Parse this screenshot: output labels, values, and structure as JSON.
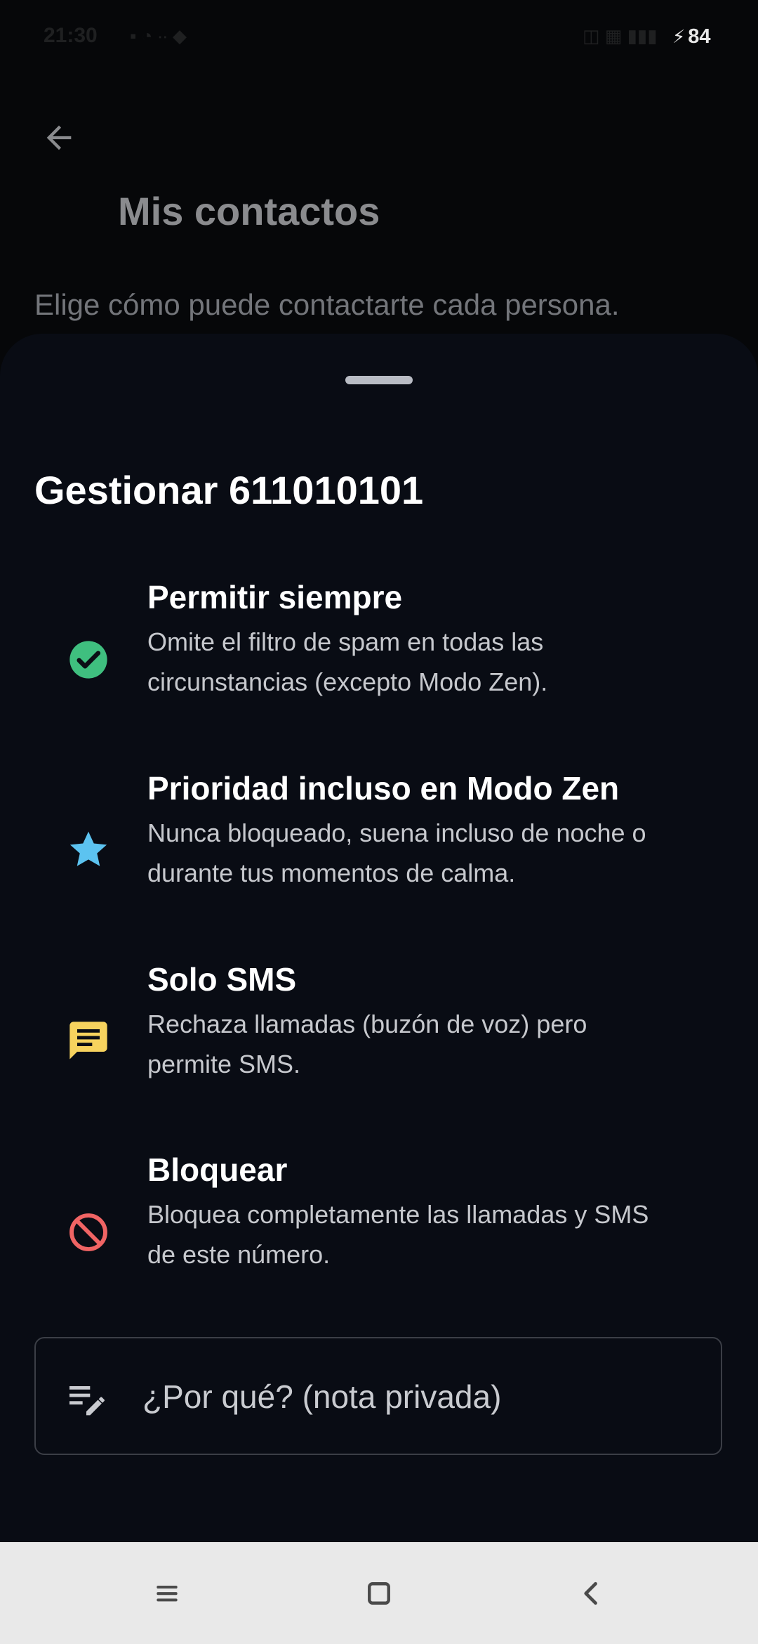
{
  "status_bar": {
    "time": "21:30",
    "notification_icons": "▪ ◔ ∙∙ ◆",
    "signal_icons": "◫ ▦ ▮▮▮",
    "battery_level": "84"
  },
  "background_page": {
    "title": "Mis contactos",
    "subtitle": "Elige cómo puede contactarte cada persona."
  },
  "sheet": {
    "title": "Gestionar 611010101",
    "options": [
      {
        "title": "Permitir siempre",
        "description_line1": "Omite el filtro de spam en todas las",
        "description_line2": "circunstancias (excepto Modo Zen).",
        "icon": "check-circle-icon",
        "color": "#3fbf7f"
      },
      {
        "title": "Prioridad incluso en Modo Zen",
        "description_line1": "Nunca bloqueado, suena incluso de noche o",
        "description_line2": "durante tus momentos de calma.",
        "icon": "star-icon",
        "color": "#5cc3f0"
      },
      {
        "title": "Solo SMS",
        "description_line1": "Rechaza llamadas (buzón de voz) pero",
        "description_line2": "permite SMS.",
        "icon": "message-icon",
        "color": "#f7d35e"
      },
      {
        "title": "Bloquear",
        "description_line1": "Bloquea completamente las llamadas y SMS",
        "description_line2": "de este número.",
        "icon": "block-icon",
        "color": "#f06464"
      }
    ],
    "note": {
      "placeholder": "¿Por qué? (nota privada)"
    }
  },
  "nav_bar": {
    "buttons": [
      "menu-icon",
      "home-icon",
      "back-icon"
    ]
  }
}
